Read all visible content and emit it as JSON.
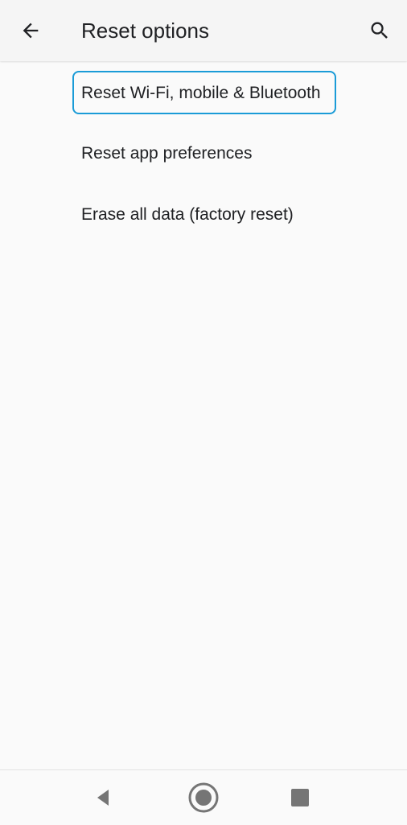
{
  "header": {
    "title": "Reset options",
    "back_icon": "arrow-back-icon",
    "search_icon": "search-icon"
  },
  "reset_options": {
    "items": [
      {
        "label": "Reset Wi-Fi, mobile & Bluetooth",
        "focused": true
      },
      {
        "label": "Reset app preferences",
        "focused": false
      },
      {
        "label": "Erase all data (factory reset)",
        "focused": false
      }
    ]
  },
  "nav_bar": {
    "back_icon": "triangle-back-icon",
    "home_icon": "circle-home-icon",
    "recents_icon": "square-recents-icon"
  },
  "colors": {
    "background": "#fafafa",
    "app_bar": "#f5f5f5",
    "focus_ring": "#1a9bd7",
    "text": "#202124",
    "nav_icon": "#757575"
  }
}
